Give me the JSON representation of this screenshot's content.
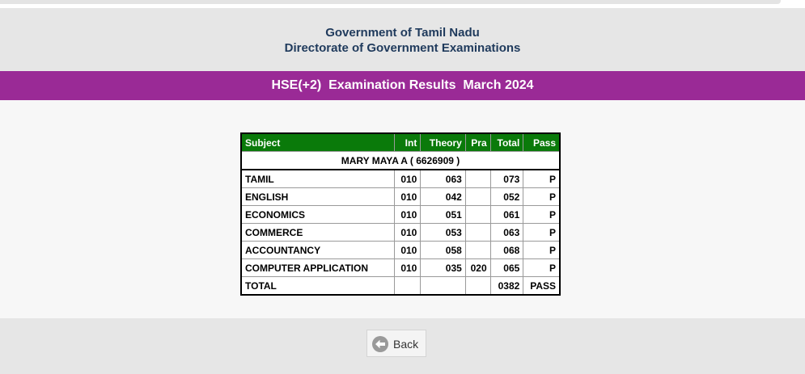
{
  "header": {
    "line1": "Government of Tamil Nadu",
    "line2": "Directorate of Government Examinations"
  },
  "banner": {
    "title": "HSE(+2)  Examination Results  March 2024",
    "color": "#9a2a96"
  },
  "student": {
    "name_line": "MARY MAYA A    ( 6626909 )"
  },
  "table": {
    "header_color": "#0a7a0a",
    "columns": [
      "Subject",
      "Int",
      "Theory",
      "Pra",
      "Total",
      "Pass"
    ],
    "rows": [
      [
        "TAMIL",
        "010",
        "063",
        "",
        "073",
        "P"
      ],
      [
        "ENGLISH",
        "010",
        "042",
        "",
        "052",
        "P"
      ],
      [
        "ECONOMICS",
        "010",
        "051",
        "",
        "061",
        "P"
      ],
      [
        "COMMERCE",
        "010",
        "053",
        "",
        "063",
        "P"
      ],
      [
        "ACCOUNTANCY",
        "010",
        "058",
        "",
        "068",
        "P"
      ],
      [
        "COMPUTER APPLICATION",
        "010",
        "035",
        "020",
        "065",
        "P"
      ],
      [
        "TOTAL",
        "",
        "",
        "",
        "0382",
        "PASS"
      ]
    ]
  },
  "footer": {
    "back_label": "Back",
    "back_icon": "arrow-left-circle-icon"
  }
}
